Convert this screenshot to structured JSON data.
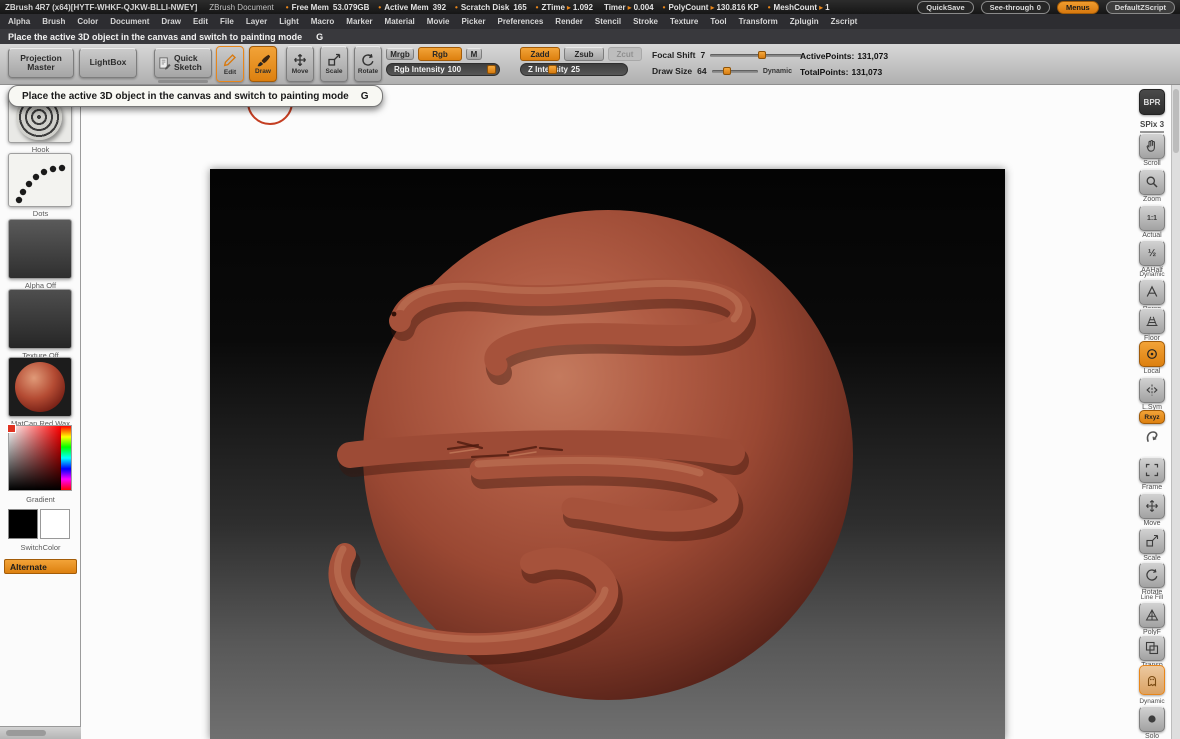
{
  "titlebar": {
    "app_title": "ZBrush 4R7 (x64)[HYTF-WHKF-QJKW-BLLI-NWEY]",
    "document_title": "ZBrush Document",
    "stats": [
      {
        "label": "Free Mem",
        "sep": "",
        "value": "53.079GB"
      },
      {
        "label": "Active Mem",
        "sep": "",
        "value": "392"
      },
      {
        "label": "Scratch Disk",
        "sep": "",
        "value": "165"
      },
      {
        "label": "ZTime",
        "sep": "▸",
        "value": "1.092"
      },
      {
        "label": "Timer",
        "sep": "▸",
        "value": "0.004"
      },
      {
        "label": "PolyCount",
        "sep": "▸",
        "value": "130.816 KP"
      },
      {
        "label": "MeshCount",
        "sep": "▸",
        "value": "1"
      }
    ],
    "quicksave": "QuickSave",
    "see_through_label": "See-through",
    "see_through_value": "0",
    "menus": "Menus",
    "default_zscript": "DefaultZScript"
  },
  "menubar": {
    "items": [
      "Alpha",
      "Brush",
      "Color",
      "Document",
      "Draw",
      "Edit",
      "File",
      "Layer",
      "Light",
      "Macro",
      "Marker",
      "Material",
      "Movie",
      "Picker",
      "Preferences",
      "Render",
      "Stencil",
      "Stroke",
      "Texture",
      "Tool",
      "Transform",
      "Zplugin",
      "Zscript"
    ]
  },
  "hintbar": {
    "text": "Place the active 3D object in the canvas and switch to painting mode",
    "key": "G"
  },
  "tooltip": {
    "text": "Place the active 3D object in the canvas and switch to painting mode",
    "key": "G"
  },
  "topshelf": {
    "projection_master": "Projection Master",
    "lightbox": "LightBox",
    "quick_sketch": "Quick Sketch",
    "edit": "Edit",
    "draw": "Draw",
    "move": "Move",
    "scale": "Scale",
    "rotate": "Rotate",
    "mrgb": "Mrgb",
    "rgb": "Rgb",
    "m": "M",
    "rgb_intensity_label": "Rgb Intensity",
    "rgb_intensity_value": "100",
    "zadd": "Zadd",
    "zsub": "Zsub",
    "zcut": "Zcut",
    "z_intensity_label": "Z Intensity",
    "z_intensity_value": "25",
    "focal_shift_label": "Focal Shift",
    "focal_shift_value": "7",
    "draw_size_label": "Draw Size",
    "draw_size_value": "64",
    "dynamic": "Dynamic",
    "active_points_label": "ActivePoints:",
    "active_points_value": "131,073",
    "total_points_label": "TotalPoints:",
    "total_points_value": "131,073"
  },
  "left_tray": {
    "brush_label": "Hook",
    "stroke_label": "Dots",
    "alpha_label": "Alpha Off",
    "texture_label": "Texture Off",
    "material_label": "MatCap Red Wax",
    "gradient_label": "Gradient",
    "switch_color_label": "SwitchColor",
    "alternate_label": "Alternate"
  },
  "right_shelf": {
    "bpr": "BPR",
    "spix_label": "SPix",
    "spix_value": "3",
    "scroll": "Scroll",
    "zoom": "Zoom",
    "actual": "Actual",
    "aahalf": "AAHalf",
    "persp_sub": "Dynamic",
    "persp": "Persp",
    "floor": "Floor",
    "local": "Local",
    "lsym": "L.Sym",
    "rxyz": "Rxyz",
    "frame": "Frame",
    "move": "Move",
    "scale": "Scale",
    "rotate": "Rotate",
    "polyf_sub": "Line Fill",
    "polyf": "PolyF",
    "transp": "Transp",
    "solo_sub": "Dynamic",
    "solo": "Solo"
  },
  "icons": {
    "actual-icon": "1:1",
    "aahalf-icon": "½",
    "stat-bullet": "•",
    "stat-arrow": "▸"
  },
  "icon_names": [
    "pencil-icon",
    "paintbrush-icon",
    "move-arrows-icon",
    "scale-box-icon",
    "rotate-arrow-icon",
    "sketch-page-icon",
    "hand-scroll-icon",
    "magnifier-zoom-icon",
    "perspective-icon",
    "floor-grid-icon",
    "local-target-icon",
    "mirror-symmetry-icon",
    "hook-icon",
    "frame-brackets-icon",
    "polyframe-icon",
    "transparency-icon",
    "ghost-icon",
    "solo-dot-icon",
    "brush-swirl-icon",
    "dots-stroke-icon"
  ],
  "colors": {
    "accent": "#e8861a",
    "sphere_base": "#a6523b",
    "canvas_top": "#040404",
    "canvas_bottom": "#707070",
    "brush_ring": "#c43e22"
  }
}
